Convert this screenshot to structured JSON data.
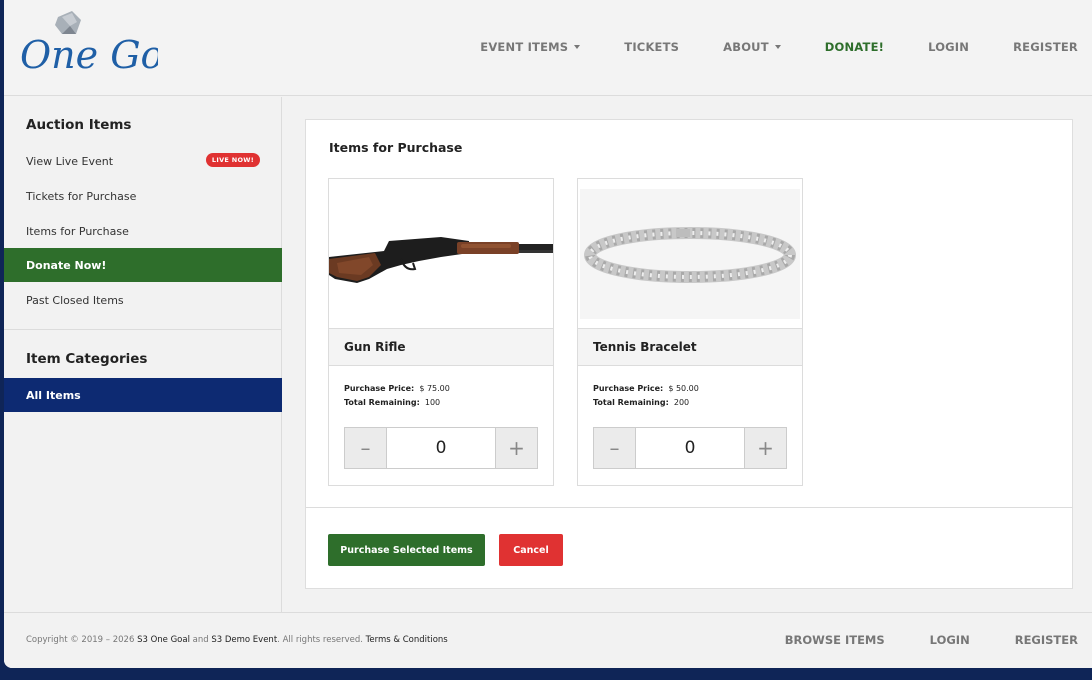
{
  "brand": {
    "logo_text": "One Goal"
  },
  "nav": {
    "items": [
      {
        "label": "EVENT ITEMS",
        "has_dropdown": true
      },
      {
        "label": "TICKETS",
        "has_dropdown": false
      },
      {
        "label": "ABOUT",
        "has_dropdown": true
      },
      {
        "label": "DONATE!",
        "has_dropdown": false
      },
      {
        "label": "LOGIN",
        "has_dropdown": false
      },
      {
        "label": "REGISTER",
        "has_dropdown": false
      }
    ]
  },
  "sidebar": {
    "auction_heading": "Auction Items",
    "auction_items": [
      {
        "label": "View Live Event",
        "badge": "LIVE NOW!"
      },
      {
        "label": "Tickets for Purchase"
      },
      {
        "label": "Items for Purchase"
      },
      {
        "label": "Donate Now!",
        "active": true
      },
      {
        "label": "Past Closed Items"
      }
    ],
    "categories_heading": "Item Categories",
    "category_items": [
      {
        "label": "All Items",
        "active": true
      }
    ]
  },
  "main": {
    "title": "Items for Purchase",
    "items": [
      {
        "name": "Gun Rifle",
        "image_icon": "rifle-image",
        "price_label": "Purchase Price:",
        "price": "$ 75.00",
        "remaining_label": "Total Remaining:",
        "remaining": "100",
        "quantity": "0",
        "minus": "–",
        "plus": "+"
      },
      {
        "name": "Tennis Bracelet",
        "image_icon": "bracelet-image",
        "price_label": "Purchase Price:",
        "price": "$ 50.00",
        "remaining_label": "Total Remaining:",
        "remaining": "200",
        "quantity": "0",
        "minus": "–",
        "plus": "+"
      }
    ],
    "purchase_button": "Purchase Selected Items",
    "cancel_button": "Cancel"
  },
  "footer": {
    "copyright_prefix": "Copyright © 2019 – 2026",
    "org": "S3 One Goal",
    "and": "and",
    "event": "S3 Demo Event",
    "rights": ". All rights reserved.",
    "terms": "Terms & Conditions",
    "links": [
      "BROWSE ITEMS",
      "LOGIN",
      "REGISTER"
    ]
  },
  "colors": {
    "green": "#2e6e2b",
    "navy": "#0d2a72",
    "red": "#e03232",
    "logo_blue": "#1f5fa6"
  }
}
